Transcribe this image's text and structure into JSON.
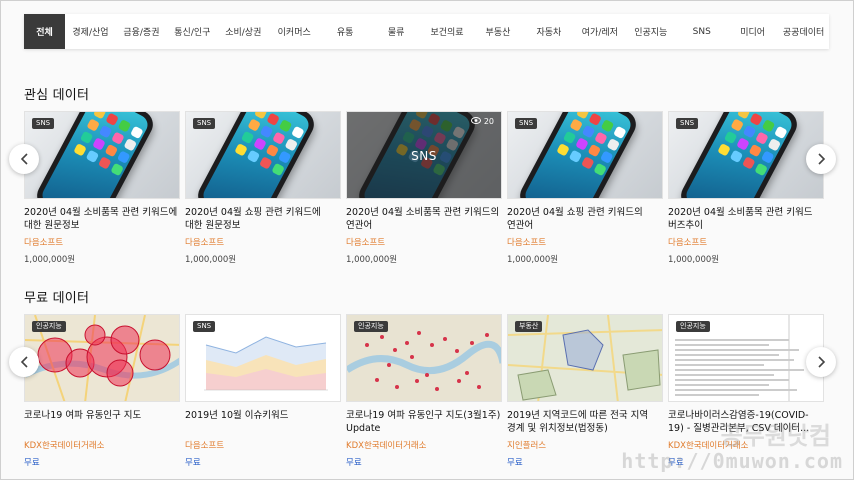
{
  "tabs": [
    "전체",
    "경제/산업",
    "금융/증권",
    "통신/인구",
    "소비/상권",
    "이커머스",
    "유통",
    "물류",
    "보건의료",
    "부동산",
    "자동차",
    "여가/레저",
    "인공지능",
    "SNS",
    "미디어",
    "공공데이터"
  ],
  "sections": {
    "interest": {
      "title": "관심 데이터",
      "cards": [
        {
          "badge": "SNS",
          "title": "2020년 04월 소비품목 관련 키워드에 대한 원문정보",
          "company": "다음소프트",
          "price": "1,000,000원"
        },
        {
          "badge": "SNS",
          "title": "2020년 04월 쇼핑 관련 키워드에 대한 원문정보",
          "company": "다음소프트",
          "price": "1,000,000원"
        },
        {
          "badge": "",
          "overlay": "SNS",
          "views": "20",
          "title": "2020년 04월 소비품목 관련 키워드의 연관어",
          "company": "다음소프트",
          "price": "1,000,000원"
        },
        {
          "badge": "SNS",
          "title": "2020년 04월 쇼핑 관련 키워드의 연관어",
          "company": "다음소프트",
          "price": "1,000,000원"
        },
        {
          "badge": "SNS",
          "title": "2020년 04월 소비품목 관련 키워드 버즈추이",
          "company": "다음소프트",
          "price": "1,000,000원"
        }
      ]
    },
    "free": {
      "title": "무료 데이터",
      "cards": [
        {
          "badge": "인공지능",
          "title": "코로나19 여파 유동인구 지도",
          "company": "KDX한국데이터거래소",
          "price": "무료"
        },
        {
          "badge": "SNS",
          "title": "2019년 10월 이슈키워드",
          "company": "다음소프트",
          "price": "무료"
        },
        {
          "badge": "인공지능",
          "title": "코로나19 여파 유동인구 지도(3월1주) Update",
          "company": "KDX한국데이터거래소",
          "price": "무료"
        },
        {
          "badge": "부동산",
          "title": "2019년 지역코드에 따른 전국 지역 경계 및 위치정보(법정동)",
          "company": "지인플러스",
          "price": "무료"
        },
        {
          "badge": "인공지능",
          "title": "코로나바이러스감염증-19(COVID-19) - 질병관리본부, CSV 데이터...",
          "company": "KDX한국데이터거래소",
          "price": "무료"
        }
      ]
    }
  },
  "watermark": {
    "text": "http://0muwon.com",
    "text_ko": "공무원닷컴"
  },
  "colors": {
    "tab_active": "#3a3a3a",
    "company": "#e07b2c",
    "free": "#2f63c9"
  }
}
